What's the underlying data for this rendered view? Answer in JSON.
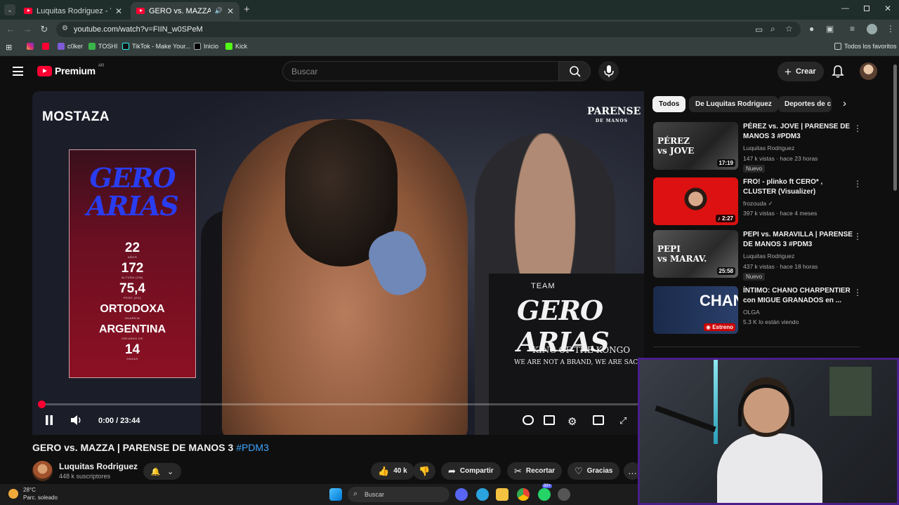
{
  "browser": {
    "tabs": [
      {
        "label": "Luquitas Rodriguez - YouTube",
        "active": false
      },
      {
        "label": "GERO vs. MAZZA | PARENSE",
        "active": true
      }
    ],
    "url": "youtube.com/watch?v=FIIN_w0SPeM",
    "bookmarks": [
      "c0ker",
      "TOSHI",
      "TikTok - Make Your...",
      "Inicio",
      "Kick"
    ],
    "all_bookmarks": "Todos los favoritos"
  },
  "header": {
    "logo": "Premium",
    "region": "AR",
    "search_placeholder": "Buscar",
    "create_label": "Crear"
  },
  "player": {
    "overlay_brand": "MOSTAZA",
    "event_logo": "PARENSE",
    "event_logo_sub": "DE MANOS",
    "stat_card": {
      "name": "GERO ARIAS",
      "stats": [
        {
          "value": "22",
          "label": "AÑOS"
        },
        {
          "value": "172",
          "label": "ALTURA (CM)"
        },
        {
          "value": "75,4",
          "label": "PESO (KG)"
        },
        {
          "value": "ORTODOXA",
          "label": "GUARDIA"
        },
        {
          "value": "ARGENTINA",
          "label": "ORIUNDO DE"
        },
        {
          "value": "14",
          "label": "ONZAS"
        }
      ]
    },
    "shirt_team": "TEAM",
    "shirt_name": "GERO ARIAS",
    "shirt_line1": "KING OF THE KONGO",
    "shirt_line2": "WE ARE NOT A BRAND, WE ARE SACRIFICE",
    "time": "0:00 / 23:44",
    "progress": 0
  },
  "video": {
    "title": "GERO vs. MAZZA | PARENSE DE MANOS 3",
    "hashtag": "#PDM3",
    "channel": "Luquitas Rodriguez",
    "subscribers": "448 k suscriptores",
    "likes": "40 k",
    "share": "Compartir",
    "clip": "Recortar",
    "thanks": "Gracias"
  },
  "sidebar": {
    "chips": [
      "Todos",
      "De Luquitas Rodriguez",
      "Deportes de c"
    ],
    "recommendations": [
      {
        "title": "PÉREZ vs. JOVE | PARENSE DE MANOS 3 #PDM3",
        "channel": "Luquitas Rodriguez",
        "meta": "147 k vistas · hace 23 horas",
        "duration": "17:19",
        "badge": "Nuevo"
      },
      {
        "title": "FRO! - plinko ft CERO* , CLUSTER (Visualizer)",
        "channel": "frozouda",
        "meta": "397 k vistas · hace 4 meses",
        "duration": "2:27",
        "badge": ""
      },
      {
        "title": "PEPI vs. MARAVILLA | PARENSE DE MANOS 3 #PDM3",
        "channel": "Luquitas Rodriguez",
        "meta": "437 k vistas · hace 18 horas",
        "duration": "25:58",
        "badge": "Nuevo"
      },
      {
        "title": "ÍNTIMO: CHANO CHARPENTIER con MIGUE GRANADOS en ...",
        "channel": "OLGA",
        "meta": "5.3 K lo están viendo",
        "duration": "Estreno",
        "badge": ""
      }
    ]
  },
  "taskbar": {
    "temp": "28°C",
    "weather": "Parc. soleado",
    "search": "Buscar",
    "badge": "99+"
  },
  "colors": {
    "accent": "#ff0033",
    "link": "#3ea6ff",
    "webcam_border": "#4a1e8a"
  }
}
